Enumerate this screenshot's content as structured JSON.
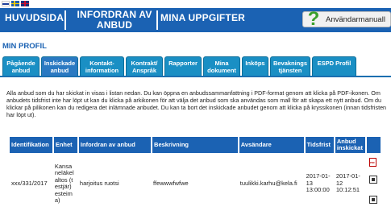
{
  "header": {
    "flags": [
      "finnish-flag-icon",
      "swedish-flag-icon",
      "english-flag-icon"
    ],
    "nav_home": "HUVUDSIDA",
    "nav_tender": "INFORDRAN AV ANBUD",
    "nav_mine": "MINA UPPGIFTER",
    "manual_label": "Användarmanuall",
    "help_icon": "?"
  },
  "page_title": "MIN PROFIL",
  "tabs": [
    {
      "label": "Pågående anbud",
      "active": false
    },
    {
      "label": "Inskickade anbud",
      "active": true
    },
    {
      "label": "Kontakt-information",
      "active": false
    },
    {
      "label": "Kontrakt/ Anspråk",
      "active": false
    },
    {
      "label": "Rapporter",
      "active": false
    },
    {
      "label": "Mina dokument",
      "active": false
    },
    {
      "label": "Inköps",
      "active": false
    },
    {
      "label": "Bevaknings tjänsten",
      "active": false
    },
    {
      "label": "ESPD Profil",
      "active": false
    }
  ],
  "intro_text": "Alla anbud som du har skickat in visas i listan nedan. Du kan öppna en anbudssammanfattning i PDF-format genom att klicka på PDF-ikonen. Om anbudets tidsfrist inte har löpt ut kan du klicka på arkikonen för att välja det anbud som ska användas som mall för att skapa ett nytt anbud. Om du klickar på pilikonen kan du redigera det inlämnade anbudet. Du kan ta bort det inskickade anbudet genom att klicka på kryssikonen (innan tidsfristen har löpt ut).",
  "table": {
    "columns": [
      "Identifikation",
      "Enhet",
      "Infordran av anbud",
      "Beskrivning",
      "Avsändare",
      "Tidsfrist",
      "Anbud inskickat",
      ""
    ],
    "rows": [
      {
        "identifikation": "xxx/331/2017",
        "enhet": "Kansa neläkel altos (t estjär) esteim a)",
        "infordran": "harjoitus ruotsi",
        "beskrivning": "ffewwwfwfwe",
        "avsandare": "tuulikki.karhu@kela.fi",
        "tidsfrist": "2017-01-13 13:00:00",
        "inskickat": "2017-01-12 10:12:51"
      }
    ]
  },
  "colors": {
    "nav_blue": "#1b62b3",
    "tab_blue": "#1a8fc4",
    "help_green": "#3aa02b"
  }
}
